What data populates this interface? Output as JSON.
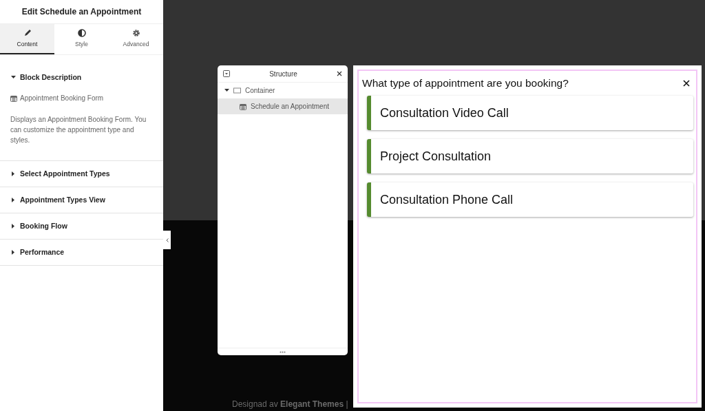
{
  "panel": {
    "title": "Edit Schedule an Appointment",
    "tabs": [
      {
        "label": "Content",
        "selected": true
      },
      {
        "label": "Style",
        "selected": false
      },
      {
        "label": "Advanced",
        "selected": false
      }
    ],
    "sections": [
      {
        "title": "Block Description",
        "expanded": true,
        "block_name": "Appointment Booking Form",
        "description": "Displays an Appointment Booking Form. You can customize the appointment type and styles."
      },
      {
        "title": "Select Appointment Types",
        "expanded": false
      },
      {
        "title": "Appointment Types View",
        "expanded": false
      },
      {
        "title": "Booking Flow",
        "expanded": false
      },
      {
        "title": "Performance",
        "expanded": false
      }
    ]
  },
  "structure": {
    "title": "Structure",
    "tree": [
      {
        "label": "Container",
        "expanded": true,
        "selected": false,
        "children": [
          {
            "label": "Schedule an Appointment",
            "selected": true
          }
        ]
      }
    ]
  },
  "booking": {
    "question": "What type of appointment are you booking?",
    "options": [
      "Consultation Video Call",
      "Project Consultation",
      "Consultation Phone Call"
    ]
  },
  "footer": "Designad av **Elegant Themes** |"
}
